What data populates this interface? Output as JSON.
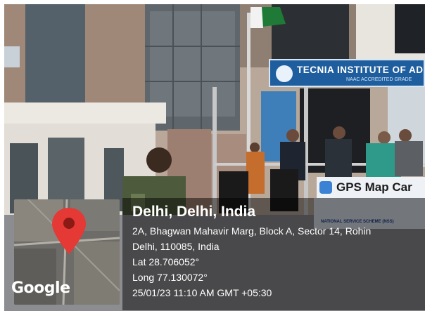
{
  "sign": {
    "title": "TECNIA INSTITUTE OF AD",
    "subtitle": "NAAC ACCREDITED GRADE"
  },
  "banner": {
    "app_name": "GPS Map Car",
    "scheme_text": "NATIONAL SERVICE SCHEME (NSS)"
  },
  "map": {
    "brand": "Google",
    "pin_color": "#e53935",
    "icon": "location-pin-icon"
  },
  "location": {
    "title": "Delhi, Delhi, India",
    "address": "2A, Bhagwan Mahavir Marg, Block A, Sector 14, Rohin",
    "city": "Delhi, 110085, India",
    "lat": "Lat 28.706052°",
    "long": "Long 77.130072°",
    "datetime": "25/01/23 11:10 AM GMT +05:30"
  },
  "colors": {
    "sign_blue": "#1f5e9e",
    "flag_green": "#1e7a36",
    "overlay": "rgba(0,0,0,0.48)"
  }
}
